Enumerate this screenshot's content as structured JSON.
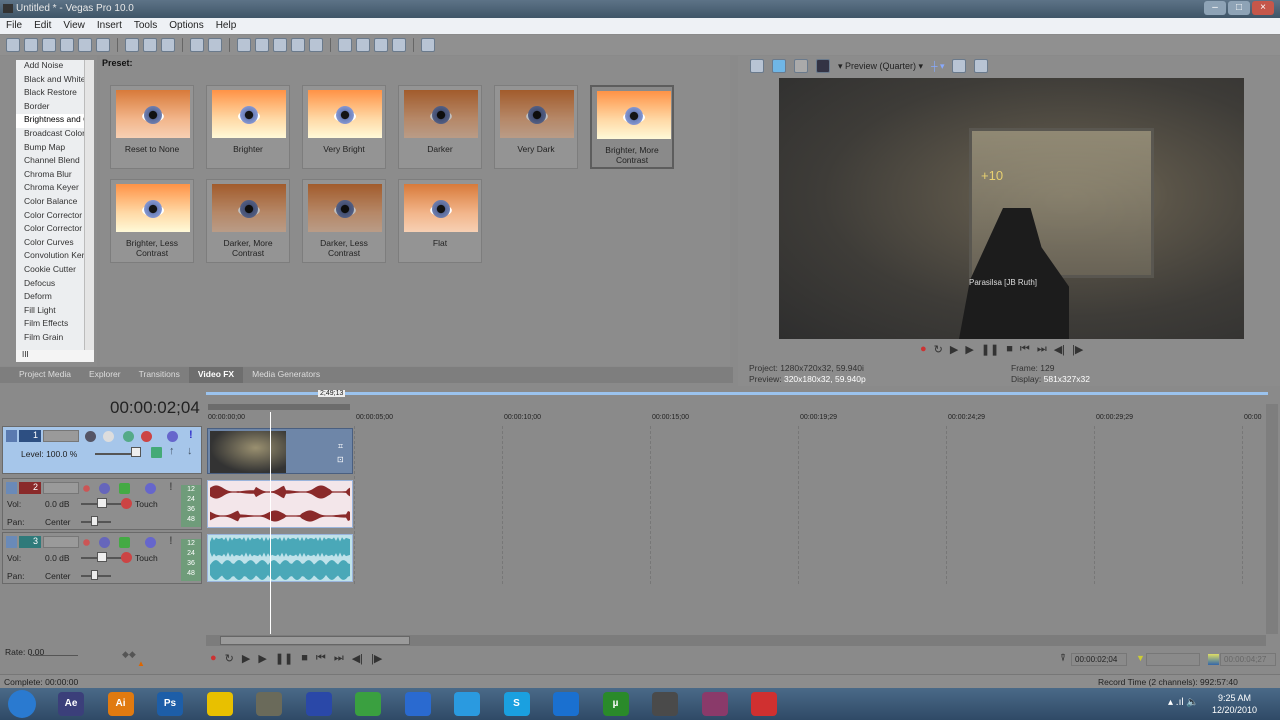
{
  "window": {
    "title": "Untitled * - Vegas Pro 10.0"
  },
  "menu": [
    "File",
    "Edit",
    "View",
    "Insert",
    "Tools",
    "Options",
    "Help"
  ],
  "toolbar_icons": [
    "new-icon",
    "open-icon",
    "save-icon",
    "save-as-icon",
    "render-icon",
    "properties-icon",
    "sep",
    "cut-icon",
    "copy-icon",
    "paste-icon",
    "sep",
    "undo-icon",
    "redo-icon",
    "sep",
    "auto-ripple-icon",
    "lock-envelopes-icon",
    "ignore-grouping-icon",
    "auto-crossfade-icon",
    "snapping-icon",
    "sep",
    "normal-edit-tool-icon",
    "envelope-tool-icon",
    "selection-tool-icon",
    "zoom-tool-icon",
    "sep",
    "what-is-this-help-icon"
  ],
  "fx_list": {
    "items": [
      "Add Noise",
      "Black and White",
      "Black Restore",
      "Border",
      "Brightness and Contrast",
      "Broadcast Colors",
      "Bump Map",
      "Channel Blend",
      "Chroma Blur",
      "Chroma Keyer",
      "Color Balance",
      "Color Corrector",
      "Color Corrector (Secondary)",
      "Color Curves",
      "Convolution Kernel",
      "Cookie Cutter",
      "Defocus",
      "Deform",
      "Fill Light",
      "Film Effects",
      "Film Grain"
    ],
    "selected": "Brightness and Contrast",
    "scroll_label": "III"
  },
  "presets": {
    "label": "Preset:",
    "items": [
      "Reset to None",
      "Brighter",
      "Very Bright",
      "Darker",
      "Very Dark",
      "Brighter, More Contrast",
      "Brighter, Less Contrast",
      "Darker, More Contrast",
      "Darker, Less Contrast",
      "Flat"
    ],
    "selected": "Brighter, More Contrast"
  },
  "tabs": [
    "Project Media",
    "Explorer",
    "Transitions",
    "Video FX",
    "Media Generators"
  ],
  "active_tab": "Video FX",
  "preview": {
    "quality": "Preview (Quarter)",
    "hud_score": "+10",
    "hud_text": "Parasilsa [JB Ruth]",
    "project_label": "Project:",
    "project_value": "1280x720x32, 59.940i",
    "preview_label": "Preview:",
    "preview_value": "320x180x32, 59.940p",
    "frame_label": "Frame:",
    "frame_value": "129",
    "display_label": "Display:",
    "display_value": "581x327x32"
  },
  "timeline": {
    "cursor_time": "00:00:02;04",
    "region_length": "2;49;13",
    "ruler": [
      "00:00:00;00",
      "00:00:05;00",
      "00:00:10;00",
      "00:00:15;00",
      "00:00:19;29",
      "00:00:24;29",
      "00:00:29;29",
      "00:00"
    ],
    "tracks": [
      {
        "num": "1",
        "color": "#2d4f82",
        "level_label": "Level:",
        "level": "100.0 %"
      },
      {
        "num": "2",
        "color": "#8a2a2a",
        "vol_label": "Vol:",
        "vol": "0.0 dB",
        "pan_label": "Pan:",
        "pan": "Center",
        "mode": "Touch",
        "meter": [
          "12",
          "24",
          "36",
          "48"
        ]
      },
      {
        "num": "3",
        "color": "#2f7a7a",
        "vol_label": "Vol:",
        "vol": "0.0 dB",
        "pan_label": "Pan:",
        "pan": "Center",
        "mode": "Touch",
        "meter": [
          "12",
          "24",
          "36",
          "48"
        ]
      }
    ],
    "rate": "Rate: 0.00",
    "transport_cursor": "00:00:02;04",
    "transport_length": "00:00:04;27"
  },
  "status": {
    "complete": "Complete: 00:00:00",
    "record_time": "Record Time (2 channels): 992:57:40"
  },
  "taskbar": {
    "apps": [
      {
        "name": "start",
        "label": "",
        "color": "#2a7ad0"
      },
      {
        "name": "after-effects",
        "label": "Ae",
        "color": "#3b3f7a"
      },
      {
        "name": "illustrator",
        "label": "Ai",
        "color": "#e07a10"
      },
      {
        "name": "photoshop",
        "label": "Ps",
        "color": "#1d5ea8"
      },
      {
        "name": "aim",
        "label": "",
        "color": "#e8c000"
      },
      {
        "name": "vegas",
        "label": "",
        "color": "#6a6a5a"
      },
      {
        "name": "firefox",
        "label": "",
        "color": "#2a48a8"
      },
      {
        "name": "chrome",
        "label": "",
        "color": "#3aa040"
      },
      {
        "name": "itunes",
        "label": "",
        "color": "#2a6ad0"
      },
      {
        "name": "quicktime",
        "label": "",
        "color": "#2a9ae0"
      },
      {
        "name": "skype",
        "label": "S",
        "color": "#1aa0e0"
      },
      {
        "name": "teamviewer",
        "label": "",
        "color": "#1a70d0"
      },
      {
        "name": "utorrent",
        "label": "µ",
        "color": "#2a8a2a"
      },
      {
        "name": "vegas-active",
        "label": "",
        "color": "#4a4a4a"
      },
      {
        "name": "winrar",
        "label": "",
        "color": "#8a3a6a"
      },
      {
        "name": "app-red",
        "label": "",
        "color": "#d03030"
      }
    ],
    "time": "9:25 AM",
    "date": "12/20/2010"
  }
}
